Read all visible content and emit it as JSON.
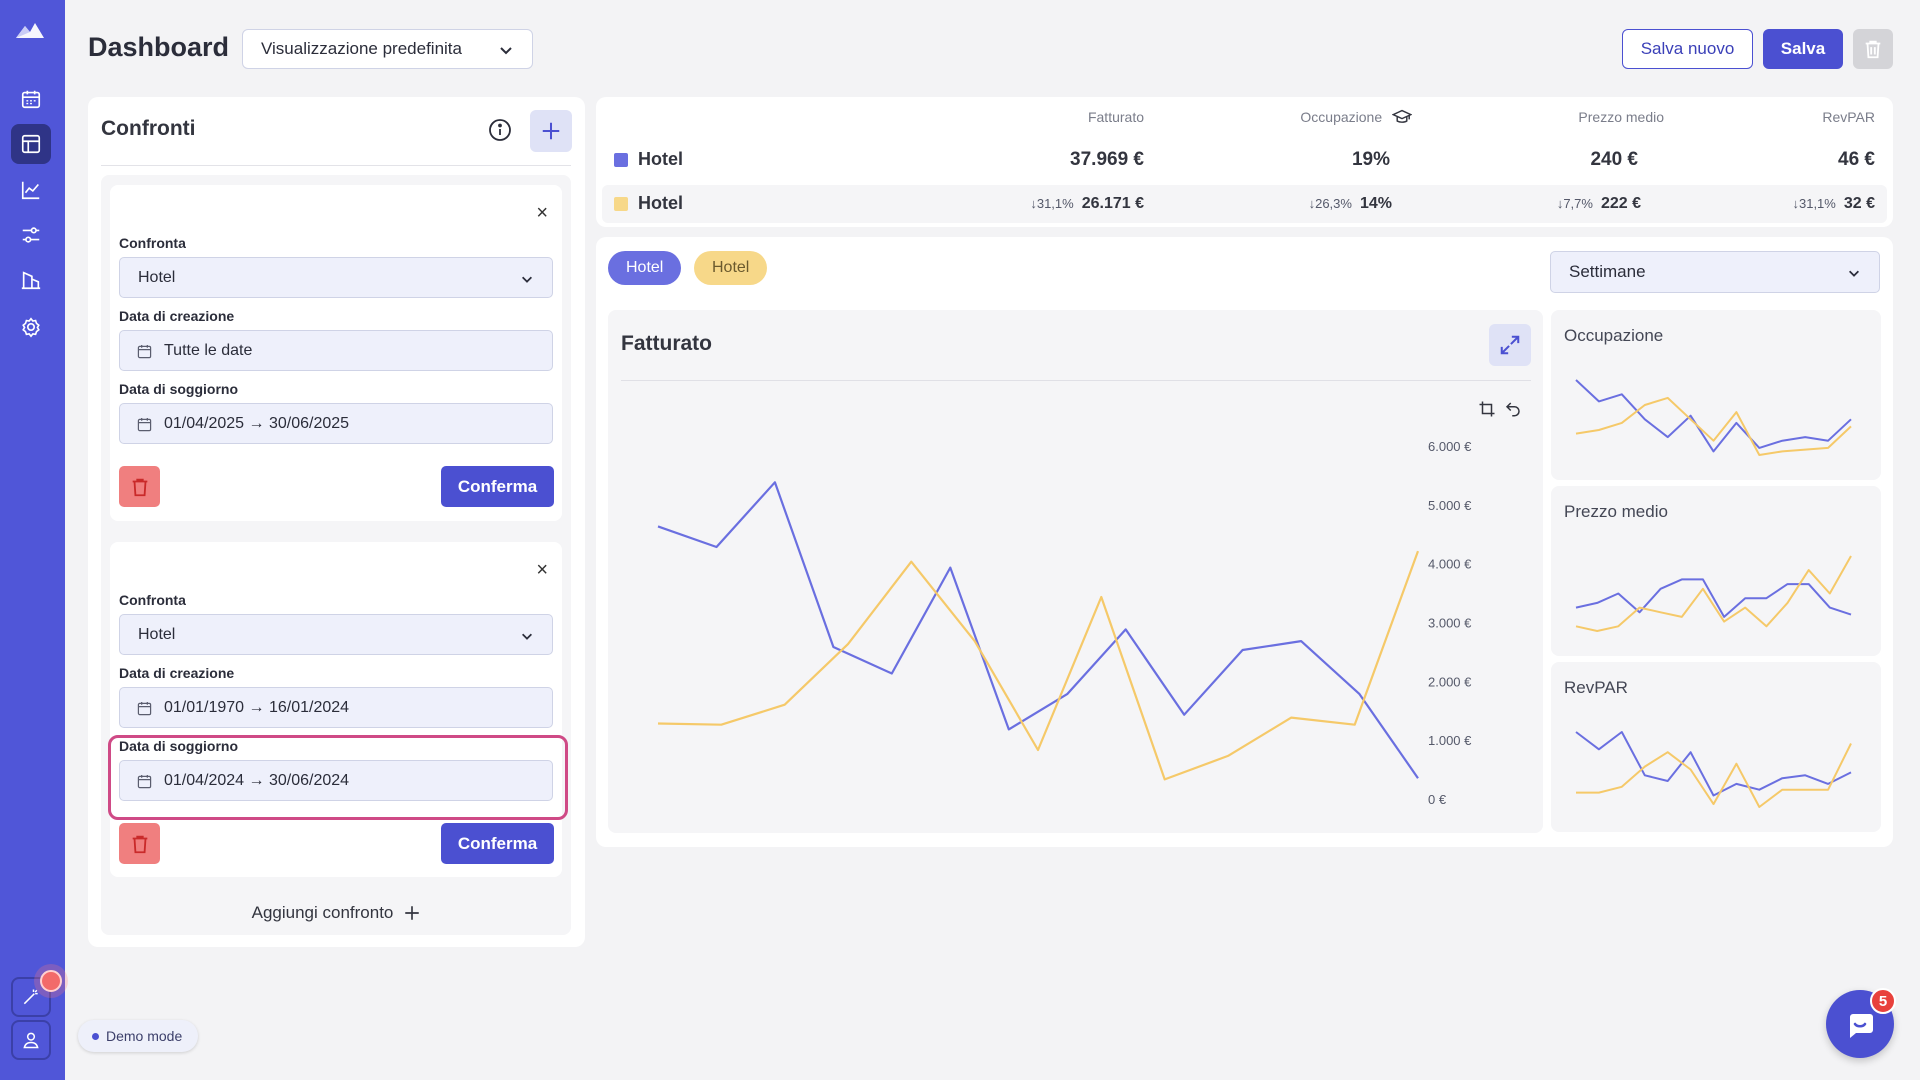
{
  "header": {
    "title": "Dashboard",
    "view_select": "Visualizzazione predefinita",
    "save_new_label": "Salva nuovo",
    "save_label": "Salva"
  },
  "sidebar": {
    "items": [
      "calendar-icon",
      "dashboard-icon",
      "chart-icon",
      "sliders-icon",
      "building-icon",
      "settings-icon"
    ],
    "active": "dashboard-icon",
    "bottom": [
      "wand-icon",
      "user-icon"
    ]
  },
  "demo_mode": "Demo mode",
  "compare_panel": {
    "title": "Confronti",
    "add_compare_label": "Aggiungi confronto",
    "cards": [
      {
        "compare_label": "Confronta",
        "compare_value": "Hotel",
        "created_label": "Data di creazione",
        "created_value": "Tutte le date",
        "stay_label": "Data di soggiorno",
        "stay_value": "01/04/2025 → 30/06/2025",
        "confirm_label": "Conferma"
      },
      {
        "compare_label": "Confronta",
        "compare_value": "Hotel",
        "created_label": "Data di creazione",
        "created_value": "01/01/1970 → 16/01/2024",
        "stay_label": "Data di soggiorno",
        "stay_value": "01/04/2024 → 30/06/2024",
        "confirm_label": "Conferma"
      }
    ]
  },
  "kpi": {
    "headers": [
      "Fatturato",
      "Occupazione",
      "Prezzo medio",
      "RevPAR"
    ],
    "rows": [
      {
        "name": "Hotel",
        "color": "#6a6fe0",
        "values": [
          "37.969 €",
          "19%",
          "240 €",
          "46 €"
        ]
      },
      {
        "name": "Hotel",
        "color": "#f7d889",
        "deltas": [
          "↓31,1%",
          "↓26,3%",
          "↓7,7%",
          "↓31,1%"
        ],
        "values": [
          "26.171 €",
          "14%",
          "222 €",
          "32 €"
        ]
      }
    ]
  },
  "filters": {
    "pills": [
      "Hotel",
      "Hotel"
    ],
    "period": "Settimane"
  },
  "colors": {
    "primary": "#4b50d1",
    "series_blue": "#6a6fe0",
    "series_yellow": "#f5c969",
    "danger": "#f07f7f"
  },
  "chart_data": [
    {
      "type": "line",
      "title": "Fatturato",
      "ylim": [
        0,
        6000
      ],
      "yticks": [
        "0 €",
        "1.000 €",
        "2.000 €",
        "3.000 €",
        "4.000 €",
        "5.000 €",
        "6.000 €"
      ],
      "series": [
        {
          "name": "Hotel",
          "color": "#6a6fe0",
          "values": [
            4650,
            4300,
            5400,
            2600,
            2150,
            3950,
            1200,
            1800,
            2900,
            1450,
            2550,
            2700,
            1800,
            370
          ]
        },
        {
          "name": "Hotel",
          "color": "#f5c969",
          "values": [
            1300,
            1280,
            1620,
            2650,
            4050,
            2700,
            850,
            3450,
            350,
            750,
            1400,
            1280,
            4230
          ]
        }
      ]
    },
    {
      "type": "line",
      "title": "Occupazione",
      "series": [
        {
          "name": "Hotel",
          "color": "#6a6fe0",
          "values": [
            82,
            70,
            74,
            60,
            50,
            62,
            42,
            58,
            44,
            48,
            50,
            48,
            60
          ]
        },
        {
          "name": "Hotel",
          "color": "#f5c969",
          "values": [
            52,
            54,
            58,
            68,
            72,
            60,
            48,
            64,
            40,
            42,
            43,
            44,
            56
          ]
        }
      ]
    },
    {
      "type": "line",
      "title": "Prezzo medio",
      "series": [
        {
          "name": "Hotel",
          "color": "#6a6fe0",
          "values": [
            60,
            62,
            66,
            58,
            68,
            72,
            72,
            56,
            64,
            64,
            70,
            70,
            60,
            57
          ]
        },
        {
          "name": "Hotel",
          "color": "#f5c969",
          "values": [
            52,
            50,
            52,
            60,
            58,
            56,
            68,
            54,
            60,
            52,
            62,
            76,
            66,
            82
          ]
        }
      ]
    },
    {
      "type": "line",
      "title": "RevPAR",
      "series": [
        {
          "name": "Hotel",
          "color": "#6a6fe0",
          "values": [
            80,
            68,
            80,
            50,
            46,
            66,
            36,
            44,
            40,
            48,
            50,
            44,
            52
          ]
        },
        {
          "name": "Hotel",
          "color": "#f5c969",
          "values": [
            38,
            38,
            42,
            56,
            66,
            54,
            30,
            58,
            28,
            40,
            40,
            40,
            72
          ]
        }
      ]
    }
  ]
}
